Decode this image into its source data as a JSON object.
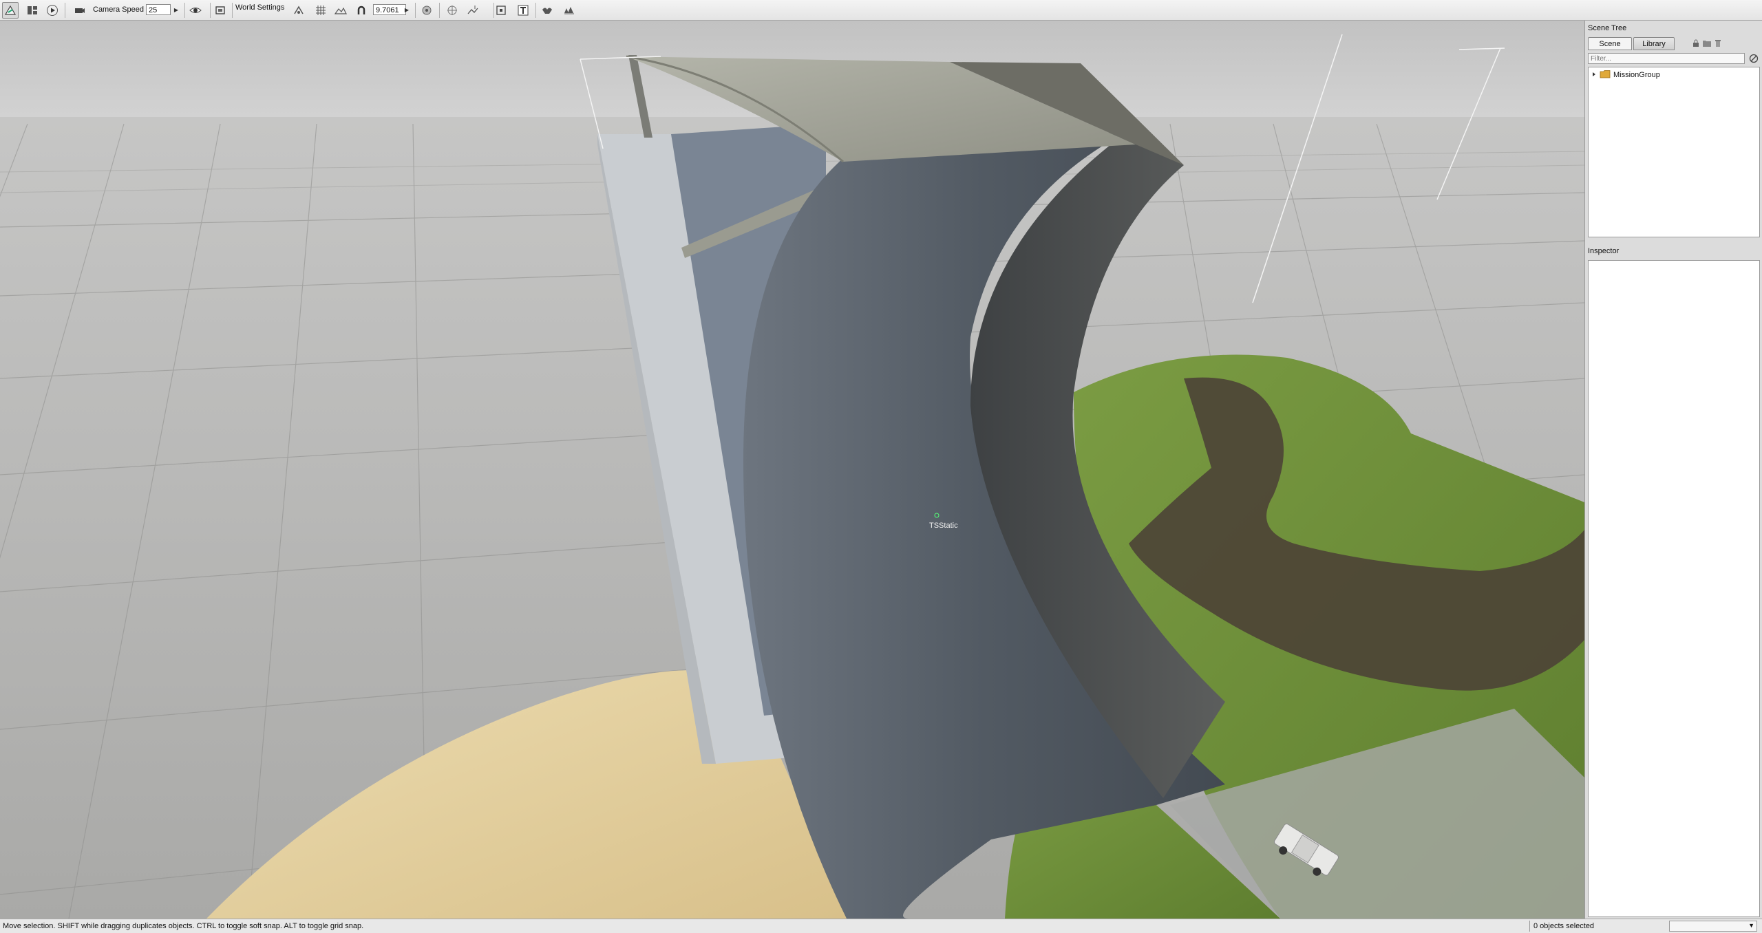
{
  "toolbar": {
    "camera_speed_label": "Camera Speed",
    "camera_speed_value": "25",
    "world_settings_label": "World Settings",
    "snap_value": "9.7061"
  },
  "viewport": {
    "object_label": "TSStatic"
  },
  "panel": {
    "scene_tree_title": "Scene Tree",
    "tabs": [
      {
        "label": "Scene",
        "active": true
      },
      {
        "label": "Library",
        "active": false
      }
    ],
    "filter_placeholder": "Filter...",
    "tree_root": "MissionGroup",
    "inspector_title": "Inspector"
  },
  "status": {
    "message": "Move selection.  SHIFT while dragging duplicates objects.  CTRL to toggle soft snap.  ALT to toggle grid snap.",
    "selected_count": "0 objects selected"
  },
  "colors": {
    "sky": "#c9c9c9",
    "floor": "#a9a9a7",
    "grass": "#6e8f3a",
    "dirt": "#4d4436",
    "sand": "#e3cf9e",
    "ramp_surface": "#5e6670",
    "wall": "#8f99a6"
  }
}
